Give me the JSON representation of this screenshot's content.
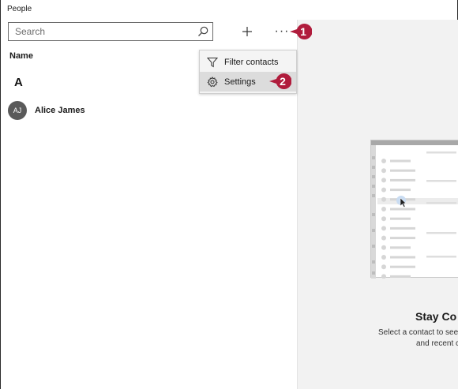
{
  "app": {
    "title": "People"
  },
  "search": {
    "placeholder": "Search",
    "value": ""
  },
  "toolbar": {
    "add_icon": "plus-icon",
    "more_label": "···"
  },
  "list": {
    "header": "Name",
    "groups": [
      {
        "letter": "A",
        "contacts": [
          {
            "initials": "AJ",
            "name": "Alice James"
          }
        ]
      }
    ]
  },
  "menu": {
    "items": [
      {
        "label": "Filter contacts",
        "icon": "filter-icon"
      },
      {
        "label": "Settings",
        "icon": "gear-icon",
        "highlighted": true
      }
    ]
  },
  "callouts": [
    {
      "number": "1"
    },
    {
      "number": "2"
    }
  ],
  "empty_state": {
    "title": "Stay Co",
    "line1": "Select a contact to see",
    "line2": "and recent c"
  },
  "colors": {
    "callout": "#b01c3c",
    "avatar": "#5a5a5a",
    "pane_bg": "#f2f2f2",
    "menu_highlight": "#dcdcdc"
  }
}
